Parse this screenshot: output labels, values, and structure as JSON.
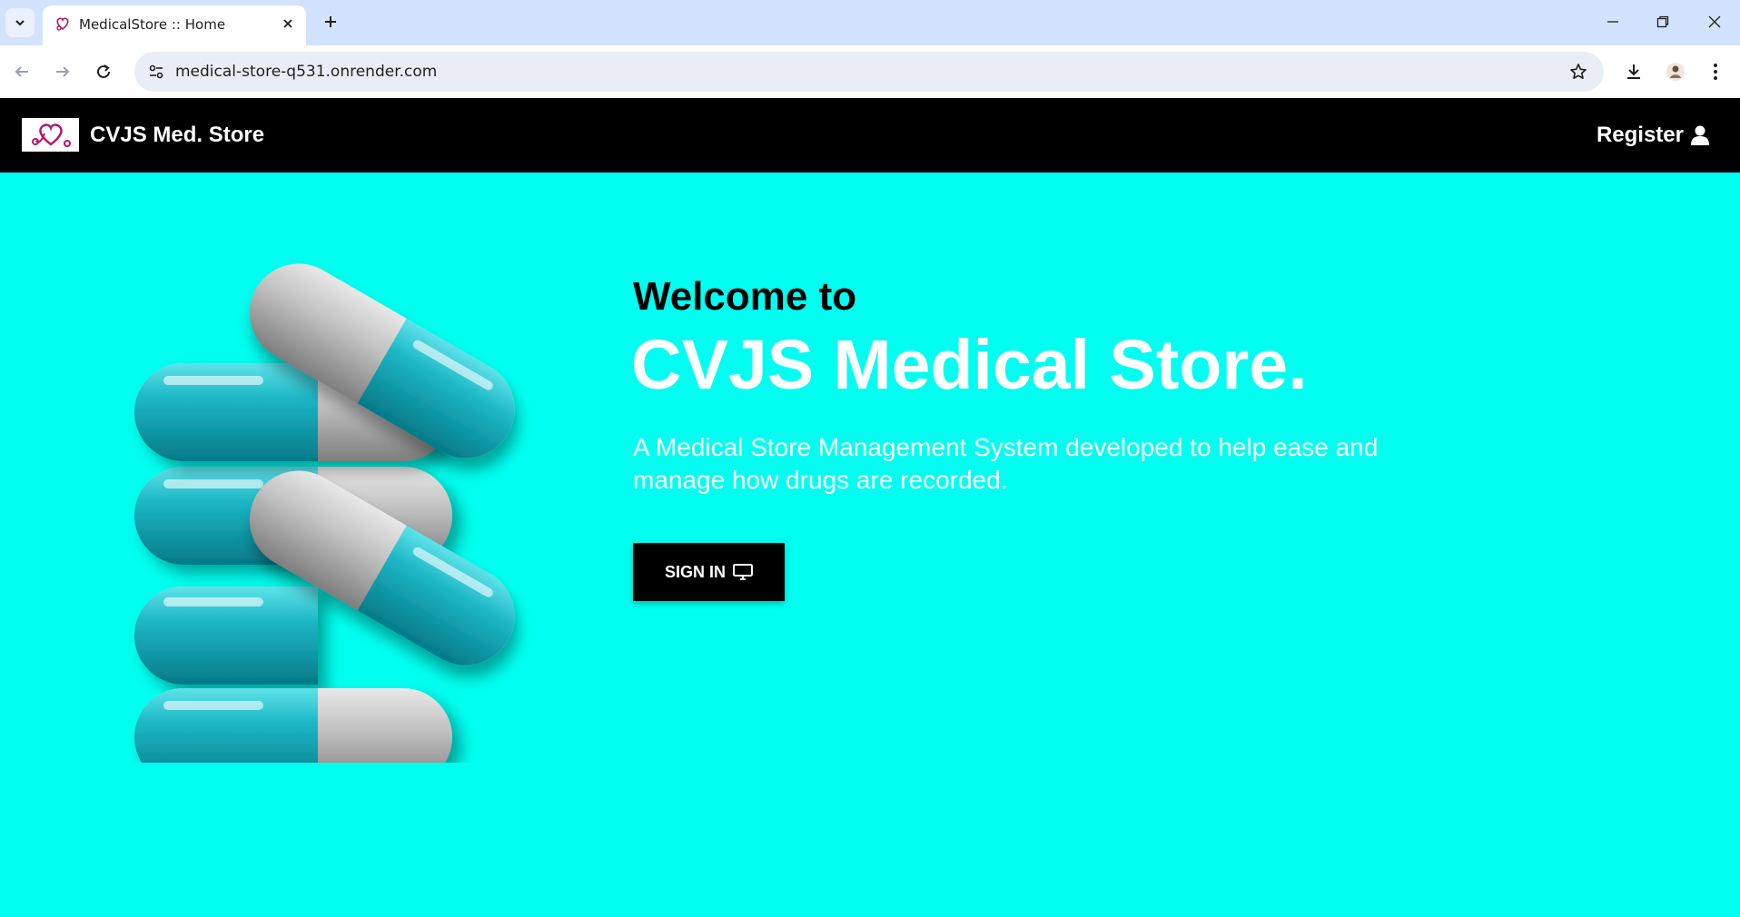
{
  "browser": {
    "tab_title": "MedicalStore :: Home",
    "url": "medical-store-q531.onrender.com",
    "icons": {
      "tab_list": "chevron-down-icon",
      "close_tab": "close-icon",
      "new_tab": "plus-icon",
      "back": "arrow-left-icon",
      "forward": "arrow-right-icon",
      "reload": "reload-icon",
      "site_info": "tune-icon",
      "bookmark": "star-icon",
      "downloads": "download-icon",
      "profile": "avatar-icon",
      "menu": "kebab-menu-icon",
      "minimize": "minimize-icon",
      "restore": "restore-icon",
      "close_window": "close-icon"
    }
  },
  "navbar": {
    "brand": "CVJS Med. Store",
    "register_label": "Register",
    "register_icon": "user-icon",
    "logo_icon": "stethoscope-heart-icon"
  },
  "hero": {
    "welcome": "Welcome to",
    "title": "CVJS Medical Store.",
    "description": "A Medical Store Management System developed to help ease and manage how drugs are recorded.",
    "signin_label": "SIGN IN",
    "signin_icon": "monitor-icon",
    "image": "capsules-illustration"
  },
  "colors": {
    "page_background": "#00fff0",
    "navbar_background": "#000000",
    "accent_teal": "#0aa5b5",
    "brand_magenta": "#b5176b"
  }
}
